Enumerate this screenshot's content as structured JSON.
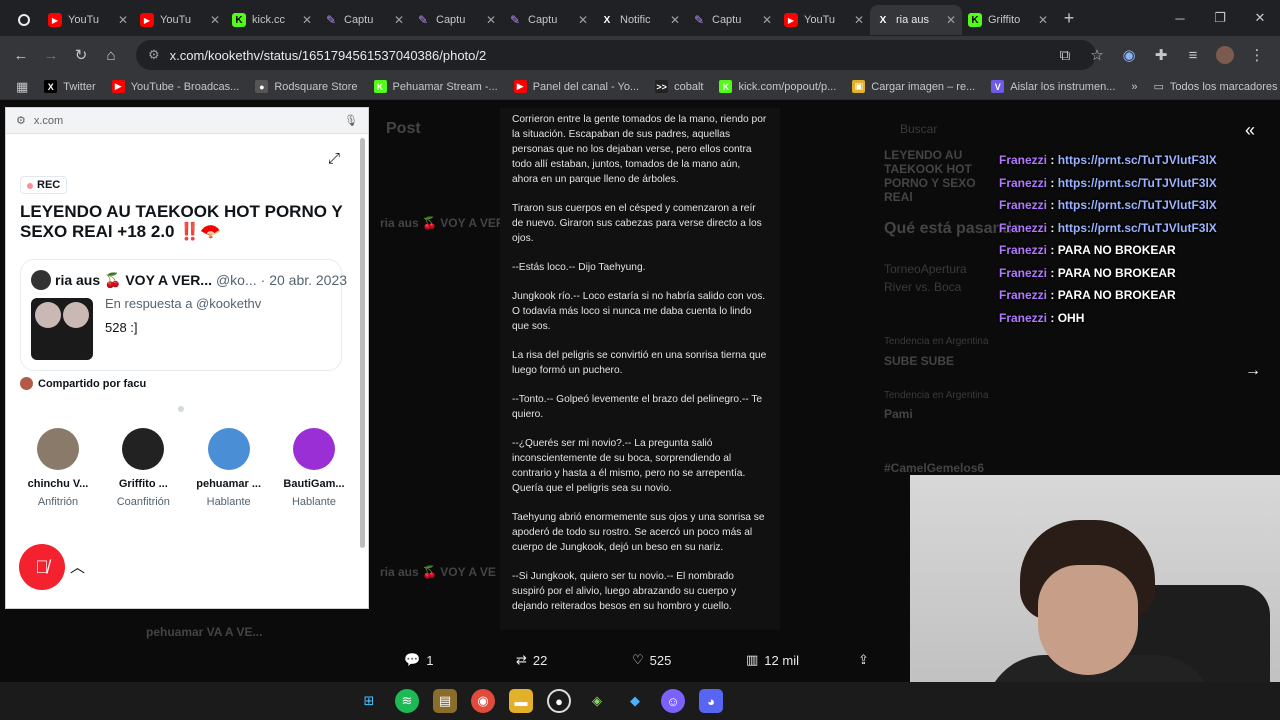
{
  "tabs": [
    {
      "label": "",
      "icon": "record-icon",
      "color": "#e8eaed"
    },
    {
      "label": "YouTu",
      "icon": "youtube-icon",
      "color": "#ff0000"
    },
    {
      "label": "YouTu",
      "icon": "youtube-icon",
      "color": "#ff0000"
    },
    {
      "label": "kick.cc",
      "icon": "kick-icon",
      "color": "#53fc18"
    },
    {
      "label": "Captu",
      "icon": "pen-icon",
      "color": "#b48cff"
    },
    {
      "label": "Captu",
      "icon": "pen-icon",
      "color": "#b48cff"
    },
    {
      "label": "Captu",
      "icon": "pen-icon",
      "color": "#b48cff"
    },
    {
      "label": "Notific",
      "icon": "x-icon",
      "color": "#ffffff"
    },
    {
      "label": "Captu",
      "icon": "pen-icon",
      "color": "#b48cff"
    },
    {
      "label": "YouTu",
      "icon": "youtube-icon",
      "color": "#ff0000"
    },
    {
      "label": "ria aus",
      "icon": "x-icon",
      "color": "#ffffff",
      "active": true
    },
    {
      "label": "Griffito",
      "icon": "kick-icon",
      "color": "#53fc18"
    }
  ],
  "url": "x.com/kookethv/status/1651794561537040386/photo/2",
  "bookmarks": [
    {
      "label": "Twitter",
      "color": "#000000",
      "glyph": "X"
    },
    {
      "label": "YouTube - Broadcas...",
      "color": "#ff0000",
      "glyph": "▶"
    },
    {
      "label": "Rodsquare Store",
      "color": "#555555",
      "glyph": "●"
    },
    {
      "label": "Pehuamar Stream -...",
      "color": "#53fc18",
      "glyph": "K"
    },
    {
      "label": "Panel del canal - Yo...",
      "color": "#ff0000",
      "glyph": "▶"
    },
    {
      "label": "cobalt",
      "color": "#222222",
      "glyph": ">>"
    },
    {
      "label": "kick.com/popout/p...",
      "color": "#53fc18",
      "glyph": "K"
    },
    {
      "label": "Cargar imagen – re...",
      "color": "#e3b02b",
      "glyph": "▣"
    },
    {
      "label": "Aislar los instrumen...",
      "color": "#6c5ce7",
      "glyph": "V"
    }
  ],
  "bookmarks_all": "Todos los marcadores",
  "popup": {
    "address": "x.com",
    "rec": "REC",
    "title": "LEYENDO AU TAEKOOK HOT PORNO Y SEXO REAl +18 2.0",
    "title_emoji": "‼️🪭",
    "card_name": "ria aus 🍒 VOY A VER...",
    "card_handle": "@ko...",
    "card_date": "· 20 abr. 2023",
    "card_reply": "En respuesta a @kookethv",
    "card_number": "528 :]",
    "shared_by": "Compartido por facu",
    "participants": [
      {
        "name": "chinchu V...",
        "role": "Anfitrión",
        "color": "#8a7a6a"
      },
      {
        "name": "Griffito ...",
        "role": "Coanfitrión",
        "color": "#222222"
      },
      {
        "name": "pehuamar ...",
        "role": "Hablante",
        "color": "#4a8fd6"
      },
      {
        "name": "BautiGam...",
        "role": "Hablante",
        "color": "#9b2fd6"
      }
    ]
  },
  "story": [
    "Corrieron entre la gente tomados de la mano, riendo por la situación. Escapaban de sus padres, aquellas personas que no los dejaban verse, pero ellos contra todo allí estaban, juntos, tomados de la mano aún, ahora en un parque lleno de árboles.",
    "Tiraron sus cuerpos en el césped y comenzaron a reír de nuevo. Giraron sus cabezas para verse directo a los ojos.",
    "--Estás loco.-- Dijo Taehyung.",
    "Jungkook río.-- Loco estaría si no habría salido con vos. O todavía más loco si nunca me daba cuenta lo lindo que sos.",
    "La risa del peligris se convirtió en una sonrisa tierna que luego formó un puchero.",
    "--Tonto.-- Golpeó levemente el brazo del pelinegro.-- Te quiero.",
    "--¿Querés ser mi novio?.-- La pregunta salió inconscientemente de su boca, sorprendiendo al contrario y hasta a él mismo, pero no se arrepentía. Quería que el peligris sea su novio.",
    "Taehyung abrió enormemente sus ojos y una sonrisa se apoderó de todo su rostro. Se acercó un poco más al cuerpo de Jungkook, dejó un beso en su nariz.",
    "--Si Jungkook, quiero ser tu novio.-- El nombrado suspiró por el alivio, luego abrazando su cuerpo y dejando reiterados besos en su hombro y cuello."
  ],
  "actions": {
    "replies": "1",
    "reposts": "22",
    "likes": "525",
    "views": "12 mil"
  },
  "chat": [
    {
      "user": "Franezzi",
      "msg": "https://prnt.sc/TuTJVlutF3lX",
      "link": true
    },
    {
      "user": "Franezzi",
      "msg": "https://prnt.sc/TuTJVlutF3lX",
      "link": true
    },
    {
      "user": "Franezzi",
      "msg": "https://prnt.sc/TuTJVlutF3lX",
      "link": true
    },
    {
      "user": "Franezzi",
      "msg": "https://prnt.sc/TuTJVlutF3lX",
      "link": true
    },
    {
      "user": "Franezzi",
      "msg": "PARA NO BROKEAR",
      "link": false
    },
    {
      "user": "Franezzi",
      "msg": "PARA NO BROKEAR",
      "link": false
    },
    {
      "user": "Franezzi",
      "msg": "PARA NO BROKEAR",
      "link": false
    },
    {
      "user": "Franezzi",
      "msg": "OHH",
      "link": false
    }
  ],
  "background_ghost": {
    "post": "Post",
    "search": "Buscar",
    "trend_title": "LEYENDO AU TAEKOOK HOT PORNO Y SEXO REAl",
    "whats_happening": "Qué está pasando",
    "trend1_name": "TorneoApertura",
    "trend1_sub": "River vs. Boca",
    "trend2_cat": "Tendencia en Argentina",
    "trend2_name": "SUBE SUBE",
    "trend3_cat": "Tendencia en Argentina",
    "trend3_name": "Pami",
    "trend4_name": "#CamelGemelos6",
    "tweet1": "ria aus 🍒 VOY A VER",
    "tweet2": "ria aus 🍒 VOY A VE",
    "tweet3": "pehuamar VA A VE..."
  }
}
